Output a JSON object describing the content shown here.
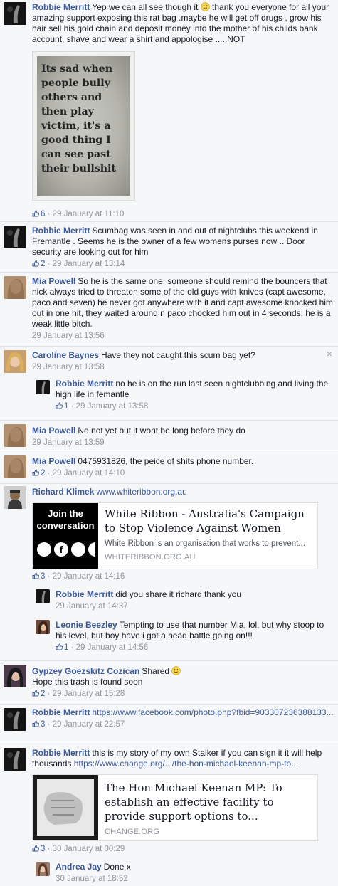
{
  "comments": [
    {
      "author": "Robbie Merritt",
      "text_a": "Yep we can all see though it",
      "text_b": "thank you everyone for all your amazing support exposing this rat bag .maybe he will get off drugs , grow his hair sell his gold chain and deposit money into the mother of his childs bank account, shave and wear a shirt and appologise .....NOT",
      "image_text": "Its sad when people bully others and then play victim, it's a good thing I can see past their bullshit",
      "likes": "6",
      "time": "29 January at 11:10"
    },
    {
      "author": "Robbie Merritt",
      "text": "Scumbag was seen in and out of nightclubs this weekend in Fremantle . Seems he is the owner of a few womens purses now .. Door security are looking out for him",
      "likes": "2",
      "time": "29 January at 13:14"
    },
    {
      "author": "Mia Powell",
      "text": "So he is the same one, someone should remind the bouncers that nick always tried to threaten some of the old guys with knives (capt awesome, paco and seven) he never got anywhere with it and capt awesome knocked him out in one hit, they waited around n paco chocked him out in 4 seconds, he is a weak little bitch.",
      "time": "29 January at 13:56"
    },
    {
      "author": "Caroline Baynes",
      "text": "Have they not caught this scum bag yet?",
      "time": "29 January at 13:58",
      "close": "×"
    },
    {
      "author": "Robbie Merritt",
      "text": "no he is on the run last seen nightclubbing and living the high life in femantle",
      "likes": "1",
      "time": "29 January at 13:58"
    },
    {
      "author": "Mia Powell",
      "text": "No not yet but it wont be long before they do",
      "time": "29 January at 13:59"
    },
    {
      "author": "Mia Powell",
      "text": "0475931826, the peice of shits phone number.",
      "likes": "2",
      "time": "29 January at 14:10"
    },
    {
      "author": "Richard Klimek",
      "link": "www.whiteribbon.org.au",
      "share": {
        "thumb_text": "Join the conversation",
        "title": "White Ribbon - Australia's Campaign to Stop Violence Against Women",
        "desc": "White Ribbon is an organisation that works to prevent...",
        "domain": "WHITERIBBON.ORG.AU"
      },
      "likes": "3",
      "time": "29 January at 14:16"
    },
    {
      "author": "Robbie Merritt",
      "text": "did you share it richard thank you",
      "time": "29 January at 14:37"
    },
    {
      "author": "Leonie Beezley",
      "text": "Tempting to use that number Mia, lol, but why stoop to his level, but boy have i got a head battle going on!!!",
      "likes": "1",
      "time": "29 January at 14:56"
    },
    {
      "author": "Gypzey Goezskitz Cozican",
      "text_a": "Shared",
      "text_b": "Hope this trash is found soon",
      "likes": "2",
      "time": "29 January at 15:28"
    },
    {
      "author": "Robbie Merritt",
      "link": "https://www.facebook.com/photo.php?fbid=903307236388133...",
      "likes": "3",
      "time": "29 January at 22:57"
    },
    {
      "author": "Robbie Merritt",
      "text": "this is my story of my own Stalker if you can sign it it will help thousands",
      "link": "https://www.change.org/.../the-hon-michael-keenan-mp-to...",
      "share": {
        "title": "The Hon Michael Keenan MP: To establish an effective facility to provide support options to...",
        "domain": "CHANGE.ORG"
      },
      "likes": "3",
      "time": "30 January at 00:29"
    },
    {
      "author": "Andrea Jay",
      "text": "Done x",
      "time": "30 January at 18:52"
    }
  ],
  "sep": " · ",
  "colors": {
    "link": "#3b5998",
    "meta": "#90949c",
    "background": "#f6f7f9"
  }
}
